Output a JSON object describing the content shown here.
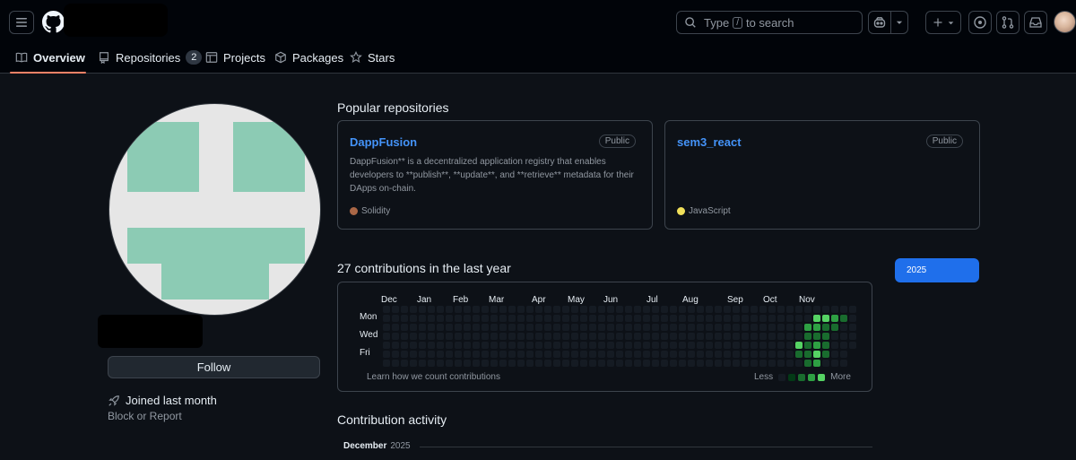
{
  "header": {
    "search_prefix": "Type",
    "search_key": "/",
    "search_suffix": "to search"
  },
  "nav": {
    "overview": "Overview",
    "repositories": "Repositories",
    "repositories_count": "2",
    "projects": "Projects",
    "packages": "Packages",
    "stars": "Stars"
  },
  "profile": {
    "follow_label": "Follow",
    "joined": "Joined last month",
    "block": "Block or Report"
  },
  "popular": {
    "title": "Popular repositories",
    "repos": [
      {
        "name": "DappFusion",
        "visibility": "Public",
        "description": "DappFusion** is a decentralized application registry that enables developers to **publish**, **update**, and **retrieve** metadata for their DApps on-chain.",
        "language": "Solidity",
        "language_color": "#aa6746"
      },
      {
        "name": "sem3_react",
        "visibility": "Public",
        "description": "",
        "language": "JavaScript",
        "language_color": "#f1e05a"
      }
    ]
  },
  "contributions": {
    "title": "27 contributions in the last year",
    "year": "2025",
    "months": [
      "Dec",
      "Jan",
      "Feb",
      "Mar",
      "Apr",
      "May",
      "Jun",
      "Jul",
      "Aug",
      "Sep",
      "Oct",
      "Nov"
    ],
    "days": [
      "Mon",
      "Wed",
      "Fri"
    ],
    "learn": "Learn how we count contributions",
    "less": "Less",
    "more": "More",
    "levels": [
      "#151b23",
      "#033a16",
      "#196c2e",
      "#2ea043",
      "#56d364"
    ]
  },
  "activity": {
    "title": "Contribution activity",
    "month": "December",
    "year": "2025"
  }
}
